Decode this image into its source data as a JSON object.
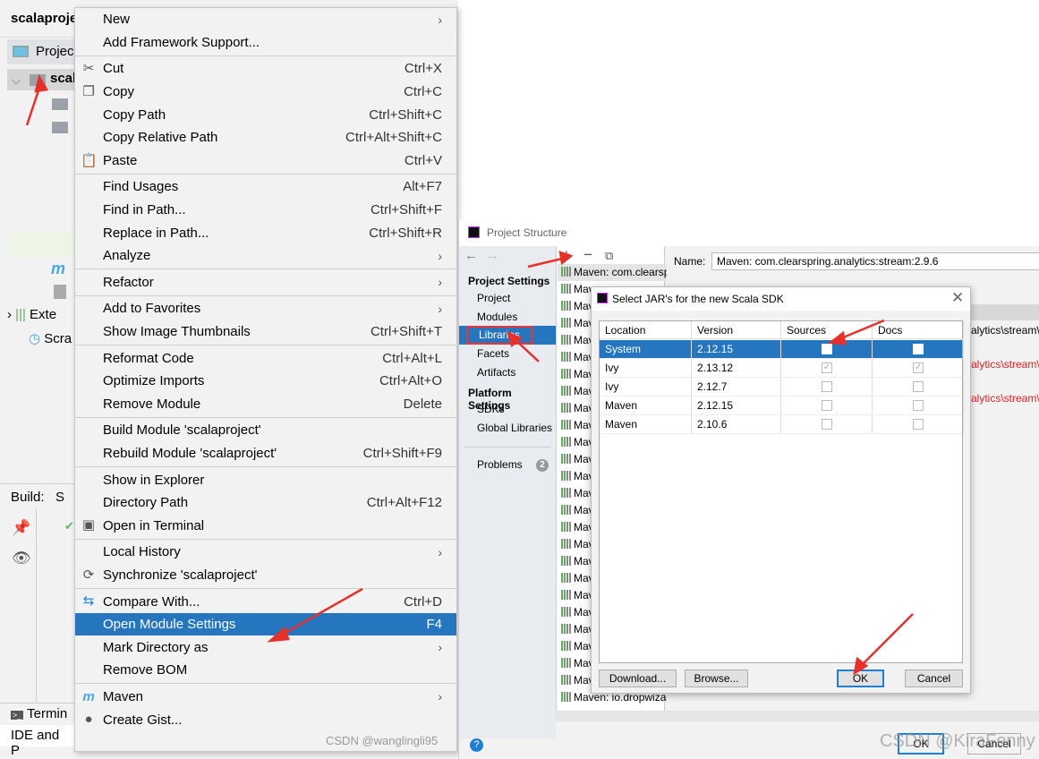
{
  "ide": {
    "project_title": "scalaproje",
    "project_tab": "Projec",
    "tree_root": "scal",
    "tree_external": "Exte",
    "tree_scratches": "Scra",
    "build_tab": "Build:",
    "build_tab2": "S",
    "terminal_tab": "Termin",
    "status": "IDE and P"
  },
  "context_menu": {
    "groups": [
      [
        {
          "label": "New",
          "submenu": true
        },
        {
          "label": "Add Framework Support..."
        }
      ],
      [
        {
          "label": "Cut",
          "shortcut": "Ctrl+X",
          "icon": "scissors-icon"
        },
        {
          "label": "Copy",
          "shortcut": "Ctrl+C",
          "icon": "copy-icon"
        },
        {
          "label": "Copy Path",
          "shortcut": "Ctrl+Shift+C"
        },
        {
          "label": "Copy Relative Path",
          "shortcut": "Ctrl+Alt+Shift+C"
        },
        {
          "label": "Paste",
          "shortcut": "Ctrl+V",
          "icon": "clipboard-icon"
        }
      ],
      [
        {
          "label": "Find Usages",
          "shortcut": "Alt+F7"
        },
        {
          "label": "Find in Path...",
          "shortcut": "Ctrl+Shift+F"
        },
        {
          "label": "Replace in Path...",
          "shortcut": "Ctrl+Shift+R"
        },
        {
          "label": "Analyze",
          "submenu": true
        }
      ],
      [
        {
          "label": "Refactor",
          "submenu": true
        }
      ],
      [
        {
          "label": "Add to Favorites",
          "submenu": true
        },
        {
          "label": "Show Image Thumbnails",
          "shortcut": "Ctrl+Shift+T"
        }
      ],
      [
        {
          "label": "Reformat Code",
          "shortcut": "Ctrl+Alt+L"
        },
        {
          "label": "Optimize Imports",
          "shortcut": "Ctrl+Alt+O"
        },
        {
          "label": "Remove Module",
          "shortcut": "Delete"
        }
      ],
      [
        {
          "label": "Build Module 'scalaproject'"
        },
        {
          "label": "Rebuild Module 'scalaproject'",
          "shortcut": "Ctrl+Shift+F9"
        }
      ],
      [
        {
          "label": "Show in Explorer"
        },
        {
          "label": "Directory Path",
          "shortcut": "Ctrl+Alt+F12"
        },
        {
          "label": "Open in Terminal",
          "icon": "terminal-icon"
        }
      ],
      [
        {
          "label": "Local History",
          "submenu": true
        },
        {
          "label": "Synchronize 'scalaproject'",
          "icon": "sync-icon"
        }
      ],
      [
        {
          "label": "Compare With...",
          "shortcut": "Ctrl+D",
          "icon": "compare-icon"
        },
        {
          "label": "Open Module Settings",
          "shortcut": "F4",
          "highlighted": true
        },
        {
          "label": "Mark Directory as",
          "submenu": true
        },
        {
          "label": "Remove BOM"
        }
      ],
      [
        {
          "label": "Maven",
          "submenu": true,
          "icon": "maven-icon"
        },
        {
          "label": "Create Gist...",
          "icon": "github-icon"
        }
      ]
    ],
    "watermark": "CSDN @wanglingli95"
  },
  "project_structure": {
    "title": "Project Structure",
    "project_settings": "Project Settings",
    "nav": [
      "Project",
      "Modules",
      "Libraries",
      "Facets",
      "Artifacts"
    ],
    "platform_settings": "Platform Settings",
    "platform_nav": [
      "SDKs",
      "Global Libraries"
    ],
    "problems": "Problems",
    "problems_count": "2",
    "selected_nav": "Libraries",
    "libraries": [
      "Maven: com.clearspring",
      "Mav",
      "Mav",
      "Mav",
      "Mav",
      "Mav",
      "Mav",
      "Mav",
      "Mav",
      "Mav",
      "Mav",
      "Mav",
      "Mav",
      "Mav",
      "Mav",
      "Mav",
      "Mav",
      "Mav",
      "Mav",
      "Mav",
      "Mav",
      "Mav",
      "Mav",
      "Mav",
      "Maven: io.airlift.airc",
      "Maven: io.dropwizar"
    ],
    "name_label": "Name:",
    "name_value": "Maven: com.clearspring.analytics:stream:2.9.6",
    "paths": [
      {
        "text": "alytics\\stream\\",
        "color": "#000000"
      },
      {
        "text": "alytics\\stream\\",
        "color": "#e02020"
      },
      {
        "text": "alytics\\stream\\",
        "color": "#e02020"
      }
    ],
    "ok": "OK",
    "cancel": "Cancel",
    "watermark": "CSDN @KiraFenny"
  },
  "dialog": {
    "title": "Select JAR's for the new Scala SDK",
    "columns": [
      "Location",
      "Version",
      "Sources",
      "Docs"
    ],
    "rows": [
      {
        "location": "System",
        "version": "2.12.15",
        "sources": false,
        "docs": false,
        "selected": true
      },
      {
        "location": "Ivy",
        "version": "2.13.12",
        "sources": true,
        "docs": true
      },
      {
        "location": "Ivy",
        "version": "2.12.7",
        "sources": false,
        "docs": false
      },
      {
        "location": "Maven",
        "version": "2.12.15",
        "sources": false,
        "docs": false
      },
      {
        "location": "Maven",
        "version": "2.10.6",
        "sources": false,
        "docs": false
      }
    ],
    "download": "Download...",
    "browse": "Browse...",
    "ok": "OK",
    "cancel": "Cancel"
  },
  "colors": {
    "selection": "#2675bf",
    "annotation_arrow": "#e8302a"
  }
}
